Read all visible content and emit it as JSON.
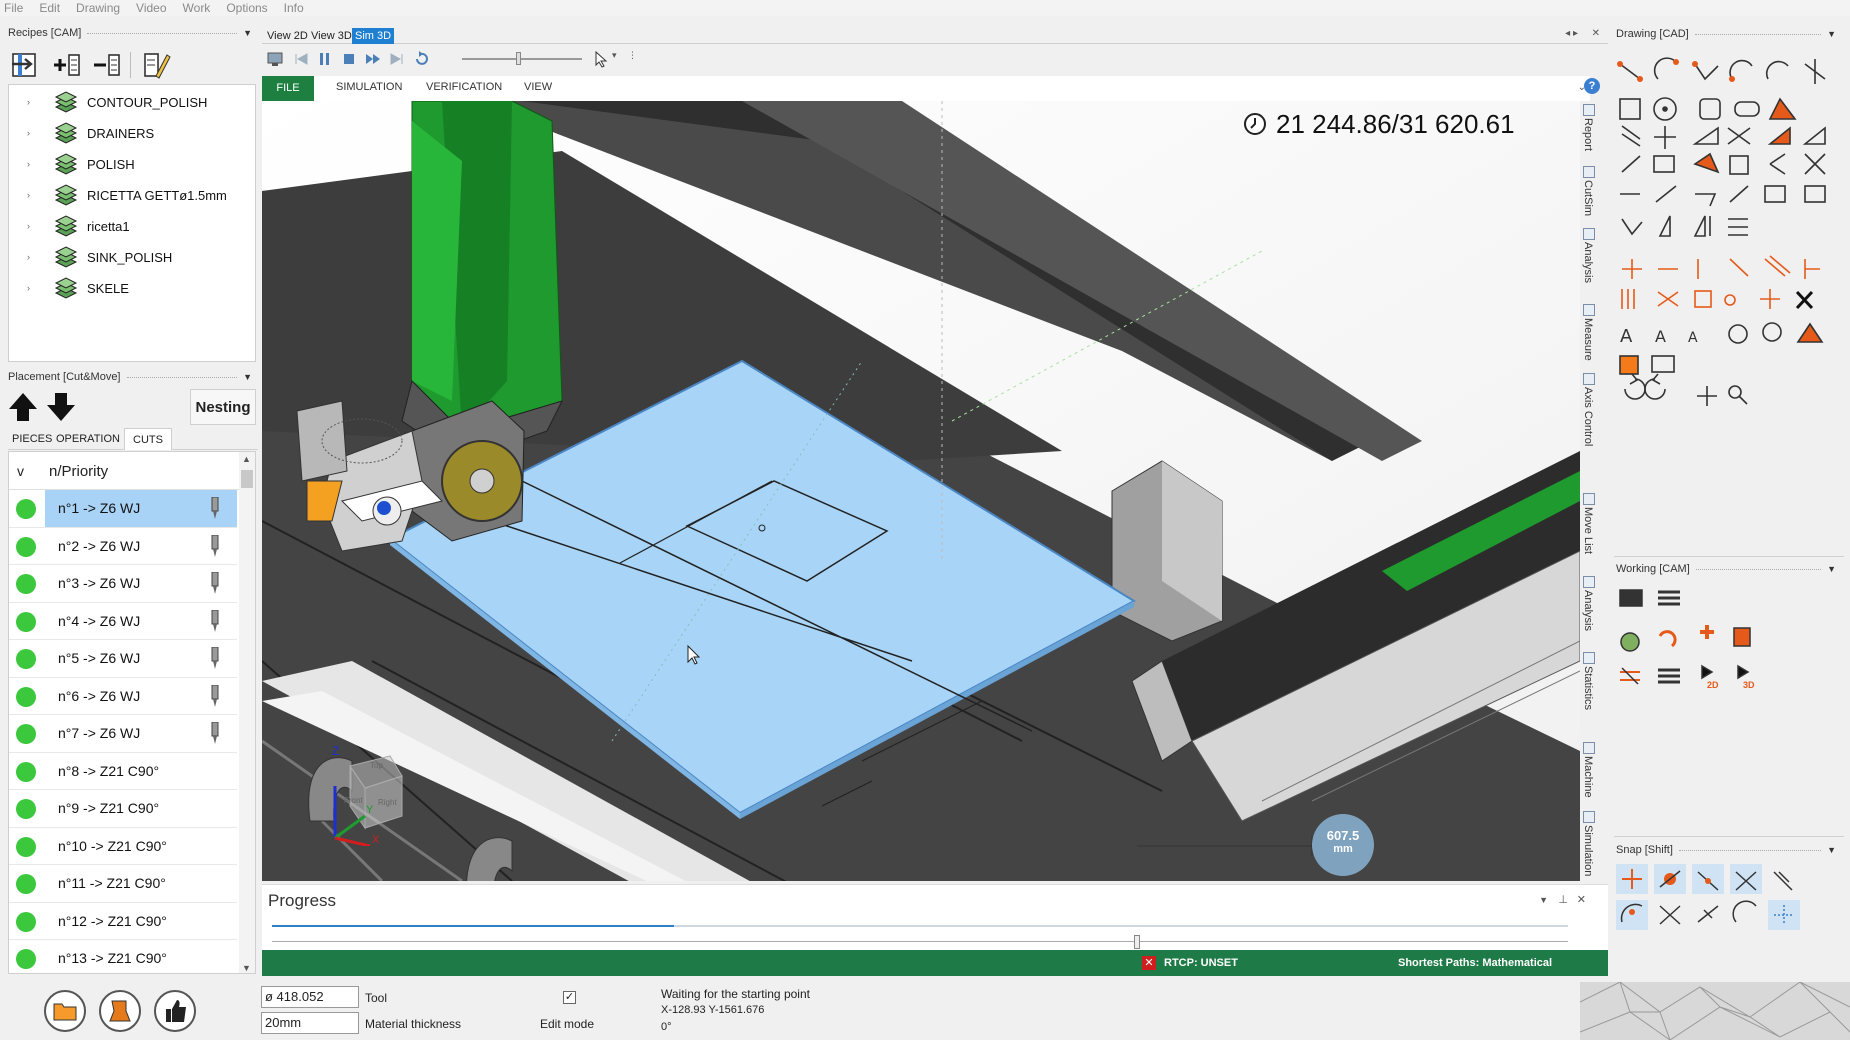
{
  "menu": [
    "File",
    "Edit",
    "Drawing",
    "Video",
    "Work",
    "Options",
    "Info"
  ],
  "recipes": {
    "title": "Recipes [CAM]",
    "items": [
      {
        "label": "CONTOUR_POLISH"
      },
      {
        "label": "DRAINERS"
      },
      {
        "label": "POLISH"
      },
      {
        "label": "RICETTA GETTø1.5mm"
      },
      {
        "label": "ricetta1"
      },
      {
        "label": "SINK_POLISH"
      },
      {
        "label": "SKELE"
      }
    ]
  },
  "placement": {
    "title": "Placement [Cut&Move]",
    "nesting_label": "Nesting",
    "tabs": [
      "PIECES",
      "OPERATION",
      "CUTS"
    ],
    "col_v": "v",
    "col_priority": "n/Priority",
    "rows": [
      {
        "label": "n°1 -> Z6 WJ",
        "has_tool": true
      },
      {
        "label": "n°2 -> Z6 WJ",
        "has_tool": true
      },
      {
        "label": "n°3 -> Z6 WJ",
        "has_tool": true
      },
      {
        "label": "n°4 -> Z6 WJ",
        "has_tool": true
      },
      {
        "label": "n°5 -> Z6 WJ",
        "has_tool": true
      },
      {
        "label": "n°6 -> Z6 WJ",
        "has_tool": true
      },
      {
        "label": "n°7 -> Z6 WJ",
        "has_tool": true
      },
      {
        "label": "n°8 -> Z21 C90°",
        "has_tool": false
      },
      {
        "label": "n°9 -> Z21 C90°",
        "has_tool": false
      },
      {
        "label": "n°10 -> Z21 C90°",
        "has_tool": false
      },
      {
        "label": "n°11 -> Z21 C90°",
        "has_tool": false
      },
      {
        "label": "n°12 -> Z21 C90°",
        "has_tool": false
      },
      {
        "label": "n°13 -> Z21 C90°",
        "has_tool": false
      }
    ]
  },
  "viewport": {
    "view_tabs": [
      "View 2D",
      "View 3D",
      "Sim 3D"
    ],
    "ribbon_tabs": [
      "FILE",
      "SIMULATION",
      "VERIFICATION",
      "VIEW"
    ],
    "counter": "21 244.86/31 620.61",
    "distance_value": "607.5",
    "distance_unit": "mm",
    "cube_labels": [
      "Top",
      "Front",
      "Right"
    ],
    "axis_labels": [
      "Z",
      "Y",
      "X"
    ],
    "side_tabs": [
      "Report",
      "CutSim",
      "Analysis",
      "Measure",
      "Axis Control",
      "Move List",
      "Analysis",
      "Statistics",
      "Machine",
      "Simulation"
    ]
  },
  "progress": {
    "title": "Progress",
    "value": 0.31,
    "status_left": "RTCP: UNSET",
    "status_right": "Shortest Paths: Mathematical"
  },
  "bottom": {
    "tool_value": "ø 418.052",
    "tool_label": "Tool",
    "thickness_value": "20mm",
    "thickness_label": "Material thickness",
    "edit_mode_label": "Edit mode",
    "status_line1": "Waiting for the starting point",
    "status_line2": "X-128.93 Y-1561.676",
    "status_line3": "0°"
  },
  "right": {
    "drawing_title": "Drawing [CAD]",
    "working_title": "Working [CAM]",
    "snap_title": "Snap [Shift]",
    "label_2d": "2D",
    "label_3d": "3D"
  },
  "colors": {
    "accent": "#1f7fd1",
    "status_green": "#1e7a46",
    "sheet_blue": "#a8d5f7",
    "machine_green": "#1e9a2e"
  }
}
